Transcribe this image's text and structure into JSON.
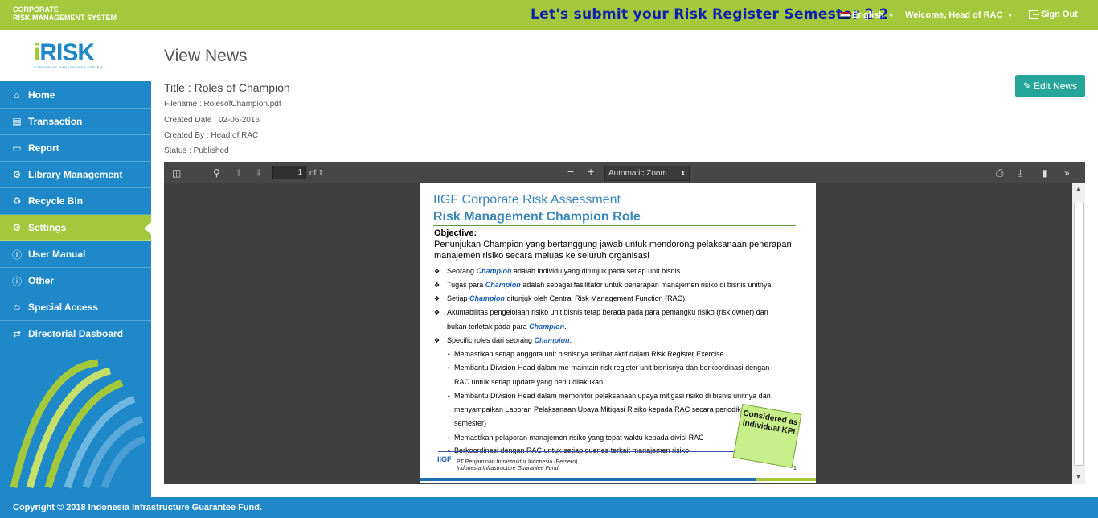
{
  "header": {
    "brand_line1": "CORPORATE",
    "brand_line2": "RISK MANAGEMENT SYSTEM",
    "announcement": "Let's submit your Risk Register Semester 2 2",
    "language": "English",
    "welcome": "Welcome, Head of RAC",
    "signout": "Sign Out"
  },
  "logo": {
    "i": "i",
    "risk": "RISK",
    "sub": "CORPORATE MANAGEMENT SYSTEM"
  },
  "sidebar": {
    "items": [
      {
        "label": "Home",
        "icon": "home-icon"
      },
      {
        "label": "Transaction",
        "icon": "book-icon"
      },
      {
        "label": "Report",
        "icon": "folder-icon"
      },
      {
        "label": "Library Management",
        "icon": "gear-icon"
      },
      {
        "label": "Recycle Bin",
        "icon": "recycle-icon"
      },
      {
        "label": "Settings",
        "icon": "gear-icon"
      },
      {
        "label": "User Manual",
        "icon": "info-icon"
      },
      {
        "label": "Other",
        "icon": "info-icon"
      },
      {
        "label": "Special Access",
        "icon": "user-icon"
      },
      {
        "label": "Directorial Dasboard",
        "icon": "exchange-icon"
      }
    ],
    "active_index": 5
  },
  "content": {
    "page_title": "View News",
    "news_title": "Title : Roles of Champion",
    "filename": "Filename : RolesofChampion.pdf",
    "created_date": "Created Date : 02-06-2016",
    "created_by": "Created By : Head of RAC",
    "status": "Status : Published",
    "edit_button": "Edit News"
  },
  "viewer": {
    "page_number": "1",
    "page_count": "of 1",
    "zoom": "Automatic Zoom",
    "minus": "−",
    "plus": "+"
  },
  "pdf": {
    "heading1": "IIGF Corporate Risk Assessment",
    "heading2": "Risk Management Champion Role",
    "objective_label": "Objective:",
    "objective_text": "Penunjukan Champion yang bertanggung jawab untuk mendorong pelaksanaan penerapan manajemen risiko secara meluas ke seluruh organisasi",
    "bullets": [
      {
        "pre": "Seorang ",
        "champ": "Champion",
        "post": " adalah individu yang ditunjuk pada setiap unit bisnis"
      },
      {
        "pre": "Tugas para ",
        "champ": "Champion",
        "post": " adalah sebagai fasilitator untuk penerapan manajemen risiko di bisnis unitnya."
      },
      {
        "pre": "Setiap ",
        "champ": "Champion",
        "post": " ditunjuk oleh Central Risk Management Function (RAC)"
      },
      {
        "pre": "Akuntabilitas pengelolaan risiko unit bisnis tetap berada pada para pemangku risiko (risk owner) dan",
        "champ": "",
        "post": ""
      }
    ],
    "bullet4_cont_pre": "bukan terletak pada para ",
    "bullet4_cont_champ": "Champion",
    "bullet4_cont_post": ".",
    "bullet5_pre": "Specific roles dari seorang ",
    "bullet5_champ": "Champion",
    "bullet5_post": ":",
    "sub_lines": [
      "Memastikan setiap anggota unit bisnisnya terlibat aktif dalam Risk Register Exercise",
      "Membantu Division Head dalam me-maintain risk register unit bisnisnya dan berkoordinasi dengan",
      "RAC untuk setiap update yang perlu dilakukan",
      "Membantu Division Head dalam memonitor pelaksanaan upaya mitigasi risiko di bisnis unitnya dan",
      "menyampaikan Laporan Pelaksanaan Upaya Mitigasi Risiko kepada RAC secara periodik (per",
      "semester)",
      "Memastikan pelaporan manajemen risiko yang tepat waktu kepada divisi RAC",
      "Berkoordinasi dengan RAC untuk setiap queries terkait manajemen risiko"
    ],
    "sticky_note": "Considered as individual KPI",
    "footer_logo": "IIGF",
    "footer_line1": "PT Penjaminan Infrastruktur Indonesia (Persero)",
    "footer_line2": "Indonesia Infrastructure Guarantee Fund",
    "page_num": "1"
  },
  "footer": {
    "copyright": "Copyright © 2018 Indonesia Infrastructure Guarantee Fund."
  },
  "colors": {
    "green": "#a3c83b",
    "blue": "#1e88c8",
    "teal": "#26a69a",
    "announce": "#0f1fb0"
  }
}
